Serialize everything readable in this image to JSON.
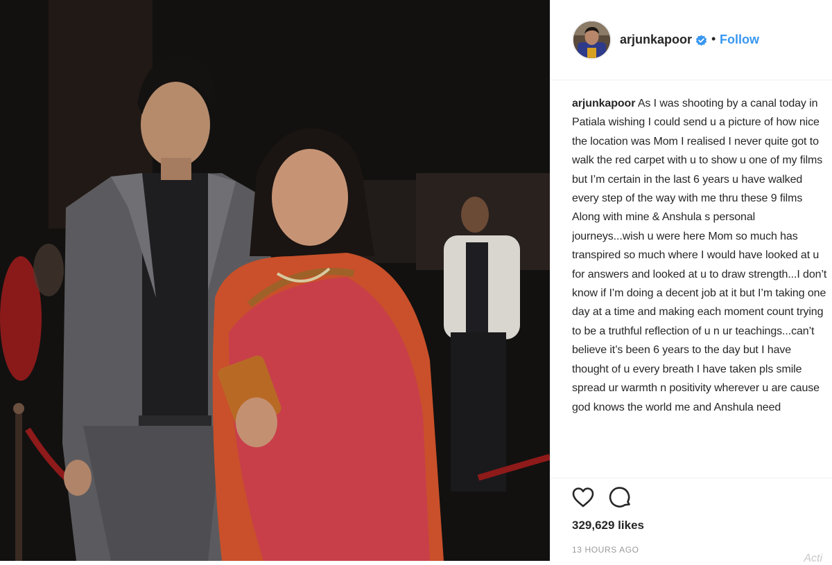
{
  "post": {
    "username": "arjunkapoor",
    "verified_icon": "verified-badge-icon",
    "separator": "•",
    "follow_label": "Follow",
    "caption_user": "arjunkapoor",
    "caption_text": "As I was shooting by a canal today in Patiala wishing I could send u a picture of how nice the location was Mom I realised I never quite got to walk the red carpet with u to show u one of my films but I’m certain in the last 6 years u have walked every step of the way with me thru these 9 films Along with mine & Anshula s personal journeys...wish u were here Mom so much has transpired so much where I would have looked at u for answers and looked at u to draw strength...I don’t know if I’m doing a decent job at it but I’m taking one day at a time and making each moment count trying to be a truthful reflection of u n ur teachings...can’t believe it’s been 6 years to the day but I have thought of u every breath I have taken pls smile spread ur warmth n positivity wherever u are cause god knows the world me and Anshula need",
    "likes": "329,629 likes",
    "timestamp": "13 HOURS AGO",
    "watermark": "Acti"
  },
  "icons": {
    "like": "heart-icon",
    "comment": "comment-bubble-icon"
  },
  "colors": {
    "follow": "#3897f0",
    "verified": "#3897f0",
    "text": "#262626",
    "muted": "#999999",
    "border": "#efefef"
  }
}
